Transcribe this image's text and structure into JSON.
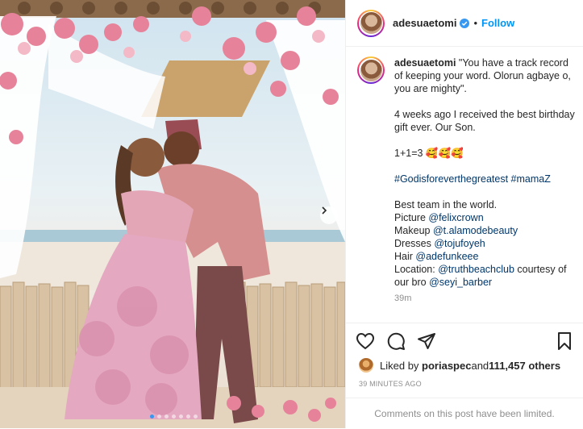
{
  "post": {
    "username": "adesuaetomi",
    "follow_label": "Follow",
    "separator": "•",
    "caption_lines": [
      "\"You have a track record of keeping your word. Olorun agbaye o, you are mighty\".",
      "4 weeks ago I received the best birthday gift ever. Our Son.",
      "1+1=3 🥰🥰🥰",
      "#Godisforeverthegreatest #mamaZ"
    ],
    "credits": {
      "intro": "Best team in the world.",
      "picture_label": "Picture ",
      "picture_handle": "@felixcrown",
      "makeup_label": "Makeup ",
      "makeup_handle": "@t.alamodebeauty",
      "dresses_label": "Dresses ",
      "dresses_handle": "@tojufoyeh",
      "hair_label": "Hair ",
      "hair_handle": "@adefunkeee",
      "location_label": "Location: ",
      "location_handle": "@truthbeachclub",
      "location_suffix": " courtesy of our bro ",
      "bro_handle": "@seyi_barber"
    },
    "caption_age": "39m",
    "likes": {
      "prefix": "Liked by ",
      "liker": "poriaspec",
      "middle": " and ",
      "count": "111,457 others"
    },
    "posted_ago": "39 MINUTES AGO",
    "comments_notice": "Comments on this post have been limited."
  },
  "carousel": {
    "total_slides": 7,
    "active_index": 0
  },
  "colors": {
    "accent": "#0095f6",
    "link": "#00376b",
    "muted": "#8e8e8e"
  },
  "icons": [
    "verified-badge-icon",
    "heart-icon",
    "comment-icon",
    "share-icon",
    "bookmark-icon",
    "chevron-right-icon"
  ]
}
